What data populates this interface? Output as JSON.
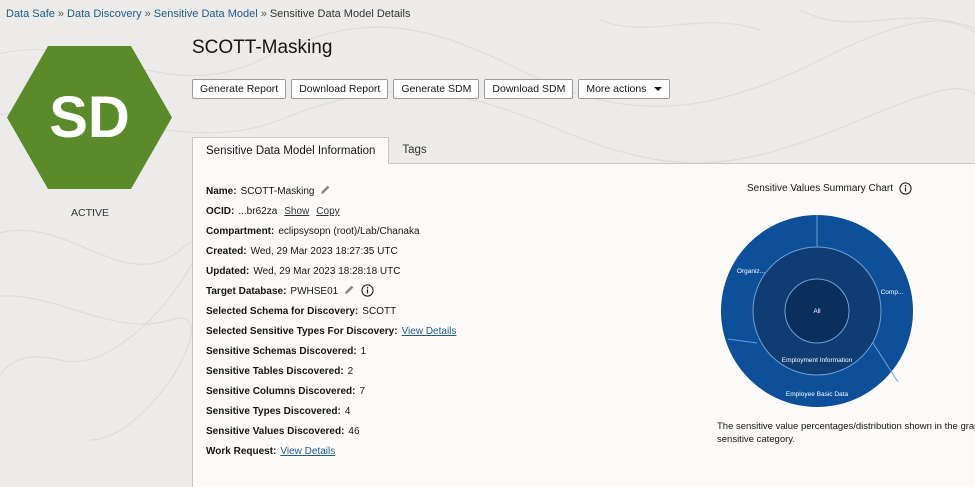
{
  "breadcrumb": [
    {
      "label": "Data Safe"
    },
    {
      "label": "Data Discovery"
    },
    {
      "label": "Sensitive Data Model"
    }
  ],
  "breadcrumb_current": "Sensitive Data Model Details",
  "breadcrumb_sep": "»",
  "badge": {
    "initials": "SD",
    "color": "#5a8a2a"
  },
  "status": "ACTIVE",
  "title": "SCOTT-Masking",
  "toolbar": {
    "generate_report": "Generate Report",
    "download_report": "Download Report",
    "generate_sdm": "Generate SDM",
    "download_sdm": "Download SDM",
    "more_actions": "More actions"
  },
  "tabs": {
    "info": "Sensitive Data Model Information",
    "tags": "Tags"
  },
  "info": {
    "name_label": "Name:",
    "name_value": "SCOTT-Masking",
    "ocid_label": "OCID:",
    "ocid_value": "...br62za",
    "ocid_show": "Show",
    "ocid_copy": "Copy",
    "compartment_label": "Compartment:",
    "compartment_value": "eclipsysopn (root)/Lab/Chanaka",
    "created_label": "Created:",
    "created_value": "Wed, 29 Mar 2023 18:27:35 UTC",
    "updated_label": "Updated:",
    "updated_value": "Wed, 29 Mar 2023 18:28:18 UTC",
    "target_label": "Target Database:",
    "target_value": "PWHSE01",
    "schema_label": "Selected Schema for Discovery:",
    "schema_value": "SCOTT",
    "types_label": "Selected Sensitive Types For Discovery:",
    "types_link": "View Details",
    "schemas_disc_label": "Sensitive Schemas Discovered:",
    "schemas_disc_value": "1",
    "tables_disc_label": "Sensitive Tables Discovered:",
    "tables_disc_value": "2",
    "columns_disc_label": "Sensitive Columns Discovered:",
    "columns_disc_value": "7",
    "types_disc_label": "Sensitive Types Discovered:",
    "types_disc_value": "4",
    "values_disc_label": "Sensitive Values Discovered:",
    "values_disc_value": "46",
    "work_label": "Work Request:",
    "work_link": "View Details"
  },
  "chart": {
    "title": "Sensitive Values Summary Chart",
    "center_label": "All",
    "inner_label": "Employment Information",
    "outer_labels": [
      "Organiz...",
      "Comp...",
      "Employee Basic Data"
    ],
    "caption_line1": "The sensitive value percentages/distribution shown in the graph",
    "caption_line2": "sensitive category.",
    "colors": {
      "center": "#0b2f5c",
      "inner": "#0e3c73",
      "outer": "#0d4f99"
    }
  }
}
